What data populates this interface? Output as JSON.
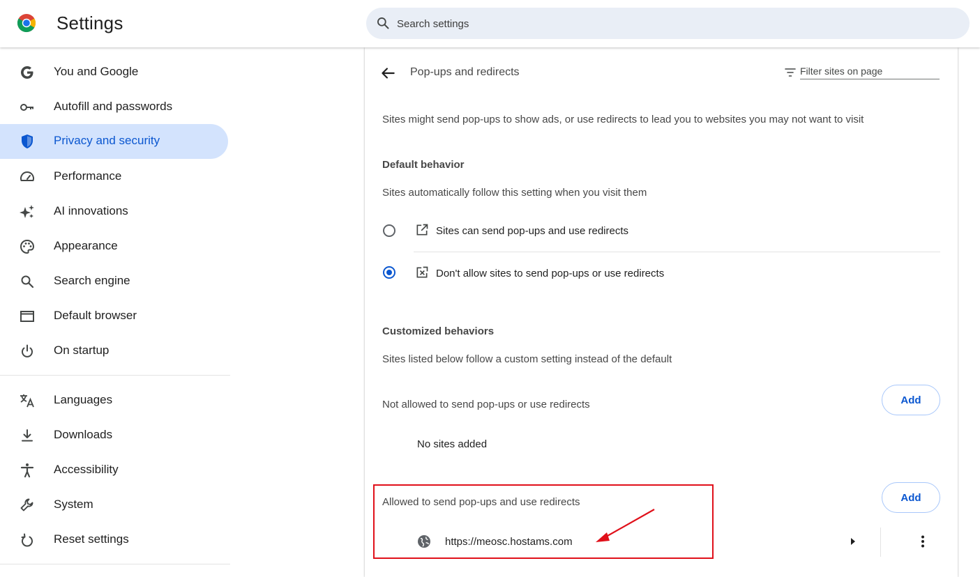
{
  "header": {
    "title": "Settings",
    "search_placeholder": "Search settings"
  },
  "sidebar": {
    "items": [
      {
        "label": "You and Google",
        "icon": "google-g-icon"
      },
      {
        "label": "Autofill and passwords",
        "icon": "key-icon"
      },
      {
        "label": "Privacy and security",
        "icon": "shield-icon",
        "active": true
      },
      {
        "label": "Performance",
        "icon": "speedometer-icon"
      },
      {
        "label": "AI innovations",
        "icon": "sparkle-icon"
      },
      {
        "label": "Appearance",
        "icon": "palette-icon"
      },
      {
        "label": "Search engine",
        "icon": "search-icon"
      },
      {
        "label": "Default browser",
        "icon": "browser-window-icon"
      },
      {
        "label": "On startup",
        "icon": "power-icon"
      },
      {
        "label": "Languages",
        "icon": "translate-icon"
      },
      {
        "label": "Downloads",
        "icon": "download-icon"
      },
      {
        "label": "Accessibility",
        "icon": "accessibility-icon"
      },
      {
        "label": "System",
        "icon": "wrench-icon"
      },
      {
        "label": "Reset settings",
        "icon": "reset-icon"
      }
    ]
  },
  "main": {
    "title": "Pop-ups and redirects",
    "filter_placeholder": "Filter sites on page",
    "description": "Sites might send pop-ups to show ads, or use redirects to lead you to websites you may not want to visit",
    "default_behavior": {
      "heading": "Default behavior",
      "subtitle": "Sites automatically follow this setting when you visit them",
      "options": [
        {
          "label": "Sites can send pop-ups and use redirects",
          "icon": "open-in-new-icon",
          "selected": false
        },
        {
          "label": "Don't allow sites to send pop-ups or use redirects",
          "icon": "popup-blocked-icon",
          "selected": true
        }
      ]
    },
    "customized": {
      "heading": "Customized behaviors",
      "subtitle": "Sites listed below follow a custom setting instead of the default",
      "not_allowed": {
        "label": "Not allowed to send pop-ups or use redirects",
        "add_label": "Add",
        "empty_text": "No sites added"
      },
      "allowed": {
        "label": "Allowed to send pop-ups and use redirects",
        "add_label": "Add",
        "sites": [
          "https://meosc.hostams.com"
        ]
      }
    }
  },
  "colors": {
    "accent": "#0b57d0",
    "active_nav_bg": "#d3e3fd",
    "annotation": "#e0101a"
  }
}
